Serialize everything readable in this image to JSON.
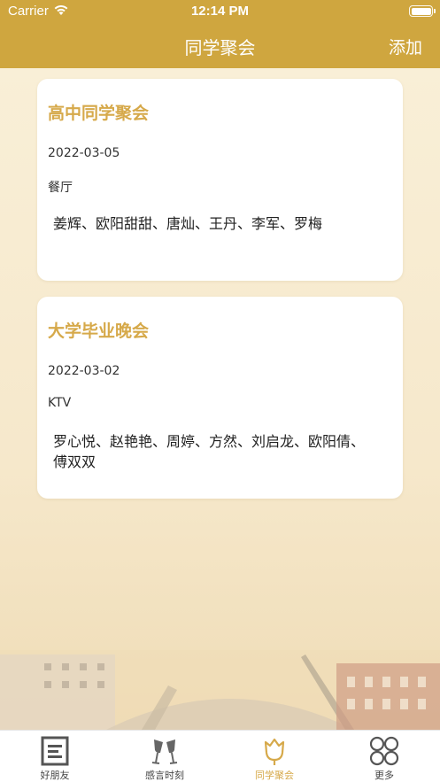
{
  "status_bar": {
    "carrier": "Carrier",
    "time": "12:14 PM"
  },
  "nav": {
    "title": "同学聚会",
    "add_label": "添加"
  },
  "gatherings": [
    {
      "title": "高中同学聚会",
      "date": "2022-03-05",
      "place": "餐厅",
      "people": "姜辉、欧阳甜甜、唐灿、王丹、李军、罗梅"
    },
    {
      "title": "大学毕业晚会",
      "date": "2022-03-02",
      "place": "KTV",
      "people": "罗心悦、赵艳艳、周婷、方然、刘启龙、欧阳倩、傅双双"
    }
  ],
  "tabs": [
    {
      "label": "好朋友",
      "icon": "document-icon",
      "active": false
    },
    {
      "label": "感言时刻",
      "icon": "champagne-glasses-icon",
      "active": false
    },
    {
      "label": "同学聚会",
      "icon": "tulip-icon",
      "active": true
    },
    {
      "label": "更多",
      "icon": "four-circles-icon",
      "active": false
    }
  ],
  "colors": {
    "accent": "#cfa63f",
    "title_gold": "#d6a94a",
    "background": "#f7ecd3"
  }
}
